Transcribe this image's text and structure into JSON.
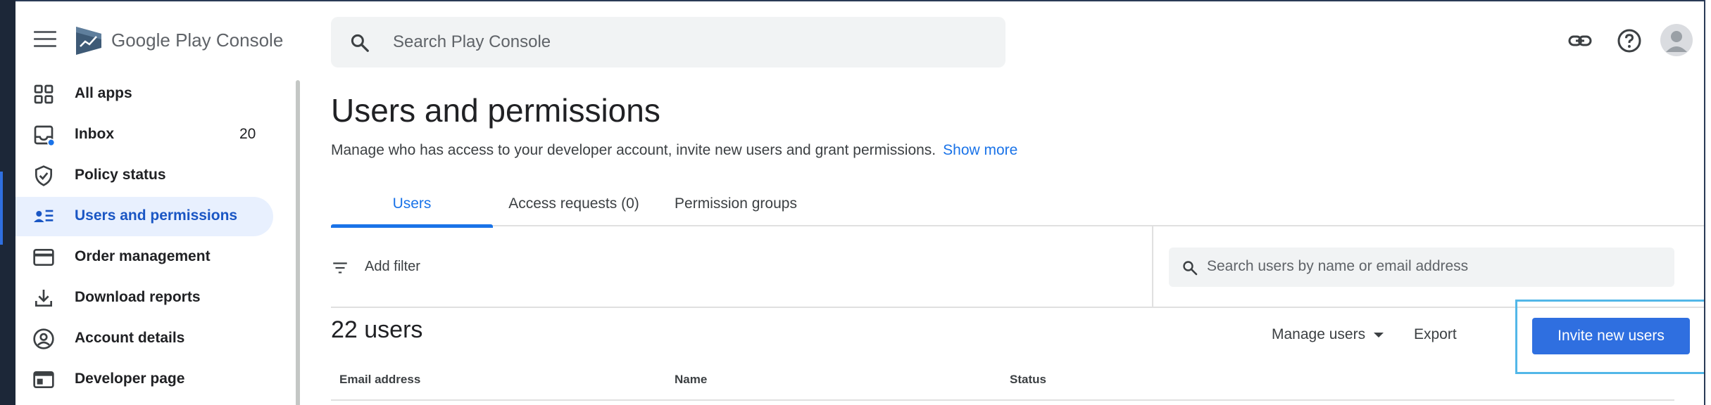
{
  "app": {
    "brand_google_play": "Google Play",
    "brand_console": "Console",
    "search_placeholder": "Search Play Console"
  },
  "sidebar": {
    "items": [
      {
        "label": "All apps",
        "icon": "grid-icon"
      },
      {
        "label": "Inbox",
        "icon": "inbox-icon",
        "count": "20"
      },
      {
        "label": "Policy status",
        "icon": "shield-check-icon"
      },
      {
        "label": "Users and permissions",
        "icon": "users-list-icon",
        "active": true
      },
      {
        "label": "Order management",
        "icon": "credit-card-icon"
      },
      {
        "label": "Download reports",
        "icon": "download-icon"
      },
      {
        "label": "Account details",
        "icon": "account-circle-icon"
      },
      {
        "label": "Developer page",
        "icon": "web-page-icon"
      }
    ]
  },
  "main": {
    "title": "Users and permissions",
    "description": "Manage who has access to your developer account, invite new users and grant permissions.",
    "show_more": "Show more",
    "tabs": [
      {
        "label": "Users",
        "active": true
      },
      {
        "label": "Access requests (0)"
      },
      {
        "label": "Permission groups"
      }
    ],
    "filter_label": "Add filter",
    "search_users_placeholder": "Search users by name or email address",
    "users_count": "22 users",
    "manage_users": "Manage users",
    "export": "Export",
    "invite": "Invite new users",
    "columns": [
      "Email address",
      "Name",
      "Status"
    ]
  },
  "colors": {
    "accent": "#1a73e8",
    "button": "#2f6fe0",
    "active_nav_bg": "#e8f0fe",
    "highlight_box": "#52b7e8"
  }
}
